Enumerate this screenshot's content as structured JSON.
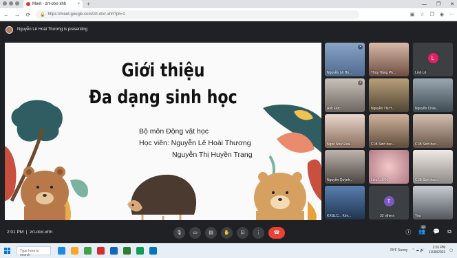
{
  "browser": {
    "tab_title": "Meet - zrt-otxr-xhh",
    "url": "https://meet.google.com/zrt-otxr-xhh?pli=1",
    "new_tab": "+",
    "minimize": "—",
    "restore": "❐",
    "close": "✕"
  },
  "meet": {
    "presenting_text": "Nguyễn Lê Hoài Thương is presenting",
    "time": "2:01 PM",
    "separator": "|",
    "meeting_code": "zrt-otxr-xhh",
    "people_count": "42"
  },
  "slide": {
    "title_line1": "Giới thiệu",
    "title_line2": "Đa dạng sinh học",
    "line1": "Bộ môn Động vật học",
    "line2": "Học viên: Nguyễn Lê Hoài Thương",
    "line3": "Nguyễn Thị Huyền Trang"
  },
  "participants": [
    {
      "name": "Nguyễn Lê Ho..."
    },
    {
      "name": "Thùy Hằng Ph..."
    },
    {
      "name": "Linh Lê",
      "initial": "L"
    },
    {
      "name": "Anh Đức..."
    },
    {
      "name": "Nguyễn Thị H..."
    },
    {
      "name": "Nguyễn Châu..."
    },
    {
      "name": "Ngọc Như Đoà..."
    },
    {
      "name": "CLB Sinh học..."
    },
    {
      "name": "CLB Sinh học..."
    },
    {
      "name": "Nguyễn Quỳnh..."
    },
    {
      "name": "Liễu LUỸN"
    },
    {
      "name": "CLB Sinh học..."
    },
    {
      "name": "KXGLC... Kim..."
    },
    {
      "name": "33 others",
      "initial": "T"
    },
    {
      "name": "You"
    }
  ],
  "taskbar": {
    "search_placeholder": "Type here to search",
    "weather": "78°F Sunny",
    "clock_time": "2:01 PM",
    "clock_date": "11/30/2021"
  },
  "colors": {
    "end_call": "#ea4335",
    "meet_bg": "#202124",
    "linh_avatar": "#e91e63",
    "others_avatar": "#7e57c2"
  }
}
